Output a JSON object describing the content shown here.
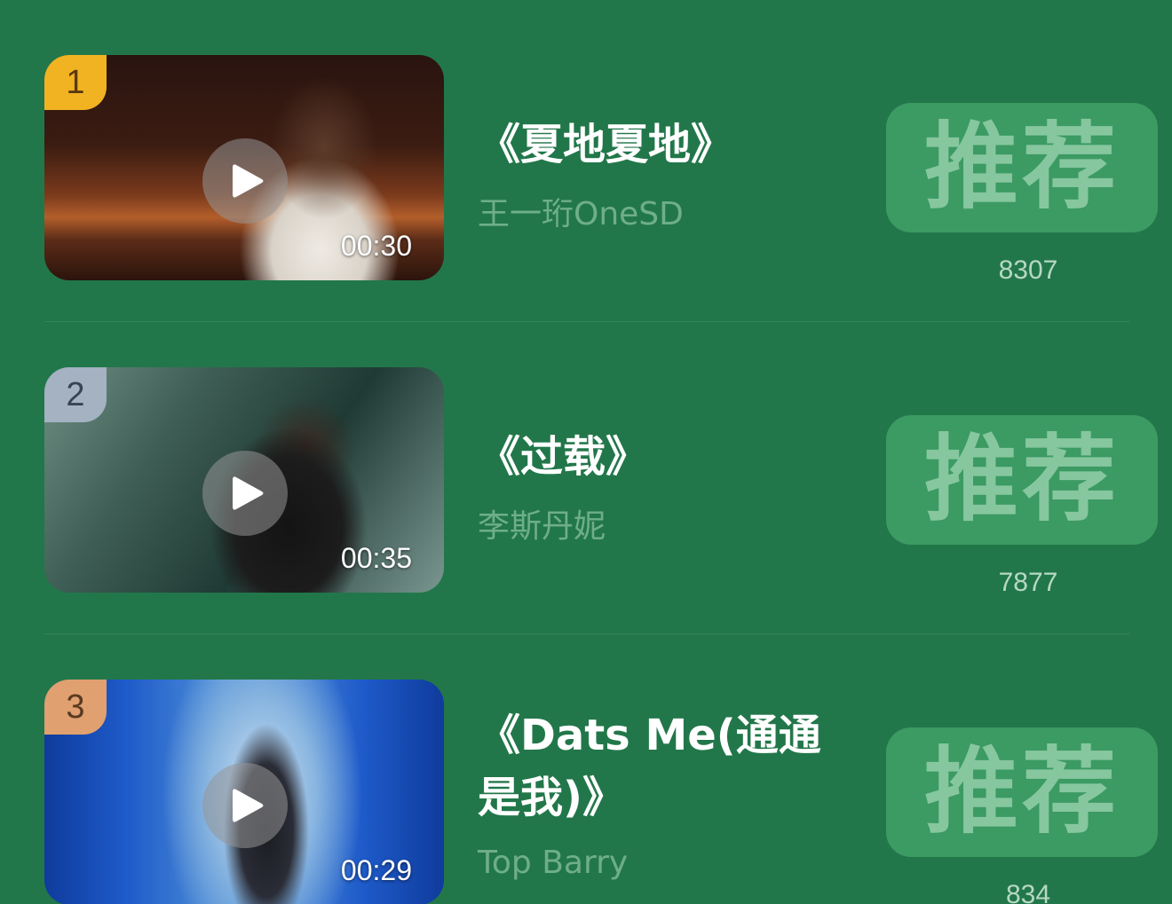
{
  "ranking_list": {
    "items": [
      {
        "rank": "1",
        "duration": "00:30",
        "title": "《夏地夏地》",
        "artist": "王一珩OneSD",
        "recommend_label": "推荐",
        "count": "8307",
        "badge_color": "#f2b323"
      },
      {
        "rank": "2",
        "duration": "00:35",
        "title": "《过载》",
        "artist": "李斯丹妮",
        "recommend_label": "推荐",
        "count": "7877",
        "badge_color": "#a4b2c2"
      },
      {
        "rank": "3",
        "duration": "00:29",
        "title": "《Dats Me(通通是我)》",
        "artist": "Top Barry",
        "recommend_label": "推荐",
        "count": "834",
        "badge_color": "#e0a070"
      }
    ]
  },
  "colors": {
    "background": "#22774a",
    "recommend_button": "#3c9a63",
    "artist_text": "#6fae8a"
  },
  "icons": {
    "play": "play-icon"
  }
}
